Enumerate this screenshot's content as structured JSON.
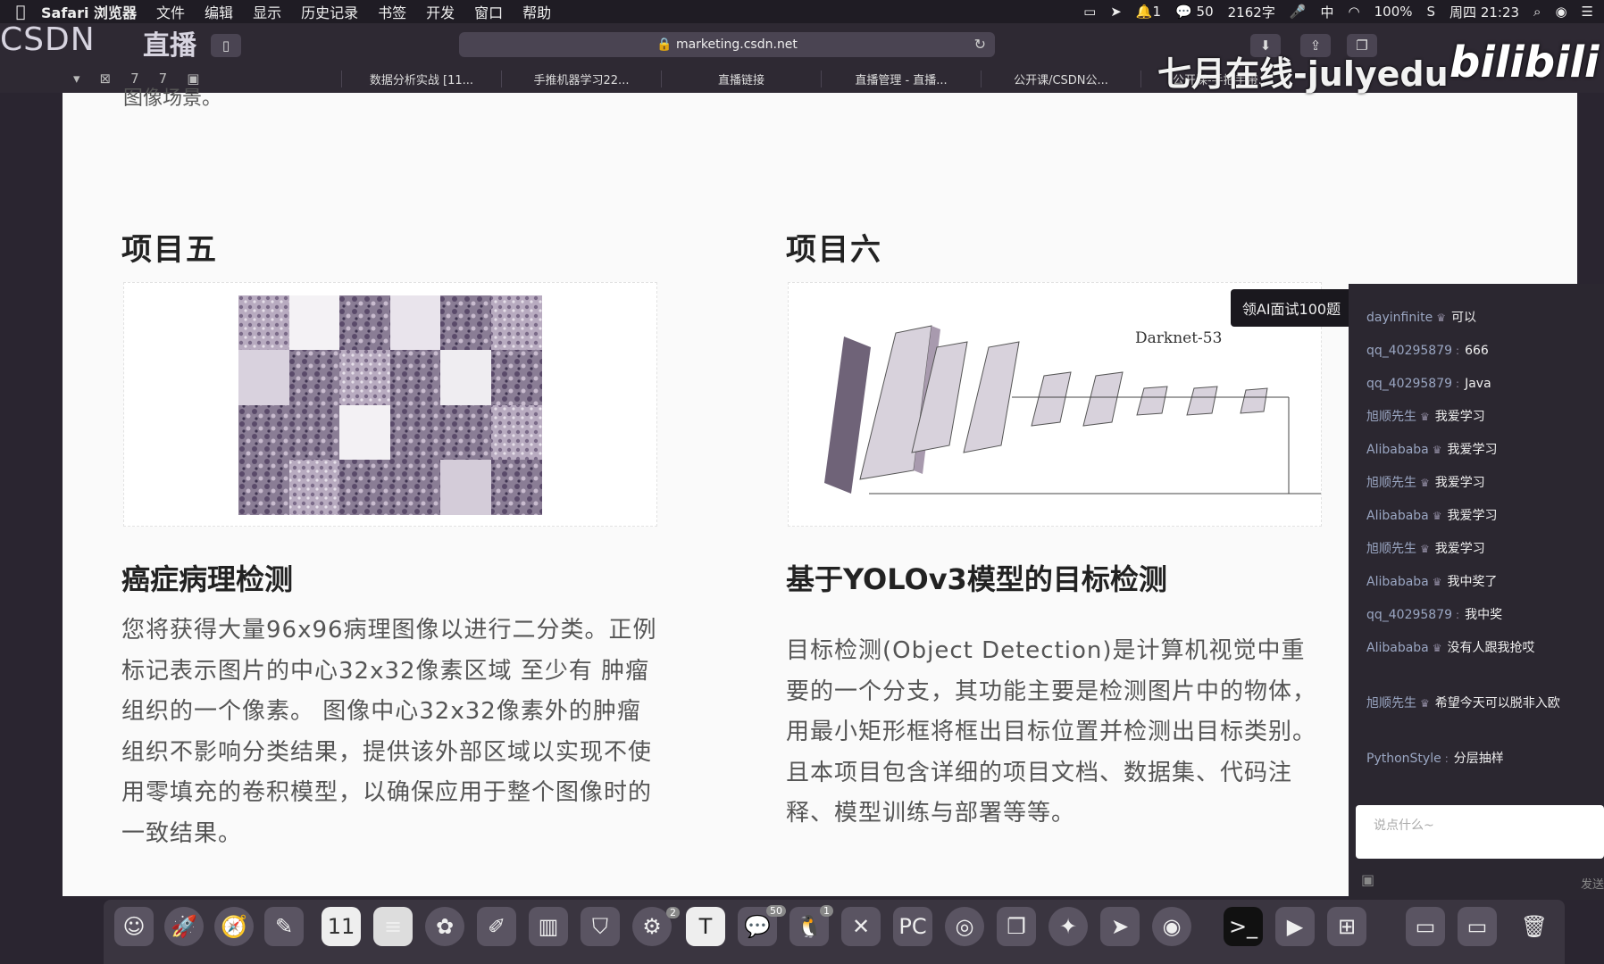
{
  "menubar": {
    "items": [
      "Safari 浏览器",
      "文件",
      "编辑",
      "显示",
      "历史记录",
      "书签",
      "开发",
      "窗口",
      "帮助"
    ],
    "status": {
      "notif": "1",
      "wechat": "50",
      "chars": "2162字",
      "ime": "中",
      "battery": "100%",
      "clock": "周四 21:23"
    }
  },
  "browser": {
    "url": "marketing.csdn.net",
    "tabs": [
      "数据分析实战 [11...",
      "手推机器学习22...",
      "直播链接",
      "直播管理 - 直播...",
      "公开课/CSDN公...",
      "公开课-手把手带..."
    ]
  },
  "overlay": {
    "csdn": "CSDN",
    "zhibo": "直播",
    "watermark": "七月在线-julyedu",
    "bilibili": "bilibili"
  },
  "page": {
    "cut_text": "图像场景。",
    "left": {
      "heading": "项目五",
      "title": "癌症病理检测",
      "paragraph": "您将获得大量96x96病理图像以进行二分类。正例标记表示图片的中心32x32像素区域 至少有 肿瘤组织的一个像素。 图像中心32x32像素外的肿瘤组织不影响分类结果，提供该外部区域以实现不使用零填充的卷积模型，以确保应用于整个图像时的一致结果。"
    },
    "right": {
      "heading": "项目六",
      "image_label": "Darknet-53",
      "title": "基于YOLOv3模型的目标检测",
      "paragraph": "目标检测(Object Detection)是计算机视觉中重要的一个分支，其功能主要是检测图片中的物体，用最小矩形框将框出目标位置并检测出目标类别。且本项目包含详细的项目文档、数据集、代码注释、模型训练与部署等等。"
    }
  },
  "promo": "领AI面试100题",
  "chat": {
    "messages": [
      {
        "user": "dayinfinite",
        "msg": "可以"
      },
      {
        "user": "qq_40295879",
        "msg": "666"
      },
      {
        "user": "qq_40295879",
        "msg": "Java"
      },
      {
        "user": "旭顺先生",
        "msg": "我爱学习"
      },
      {
        "user": "Alibababa",
        "msg": "我爱学习"
      },
      {
        "user": "旭顺先生",
        "msg": "我爱学习"
      },
      {
        "user": "Alibababa",
        "msg": "我爱学习"
      },
      {
        "user": "旭顺先生",
        "msg": "我爱学习"
      },
      {
        "user": "Alibababa",
        "msg": "我中奖了"
      },
      {
        "user": "qq_40295879",
        "msg": "我中奖"
      },
      {
        "user": "Alibababa",
        "msg": "没有人跟我抢哎"
      },
      {
        "user": "旭顺先生",
        "msg": "希望今天可以脱非入欧"
      },
      {
        "user": "PythonStyle",
        "msg": "分层抽样"
      }
    ],
    "input_placeholder": "说点什么~",
    "send_label": "发送"
  },
  "dock": {
    "badges": {
      "sysprefs": "2",
      "wechat": "50",
      "qq": "1"
    },
    "labels": {
      "calendar": "11",
      "typora": "T",
      "pycharm": "PC"
    }
  }
}
